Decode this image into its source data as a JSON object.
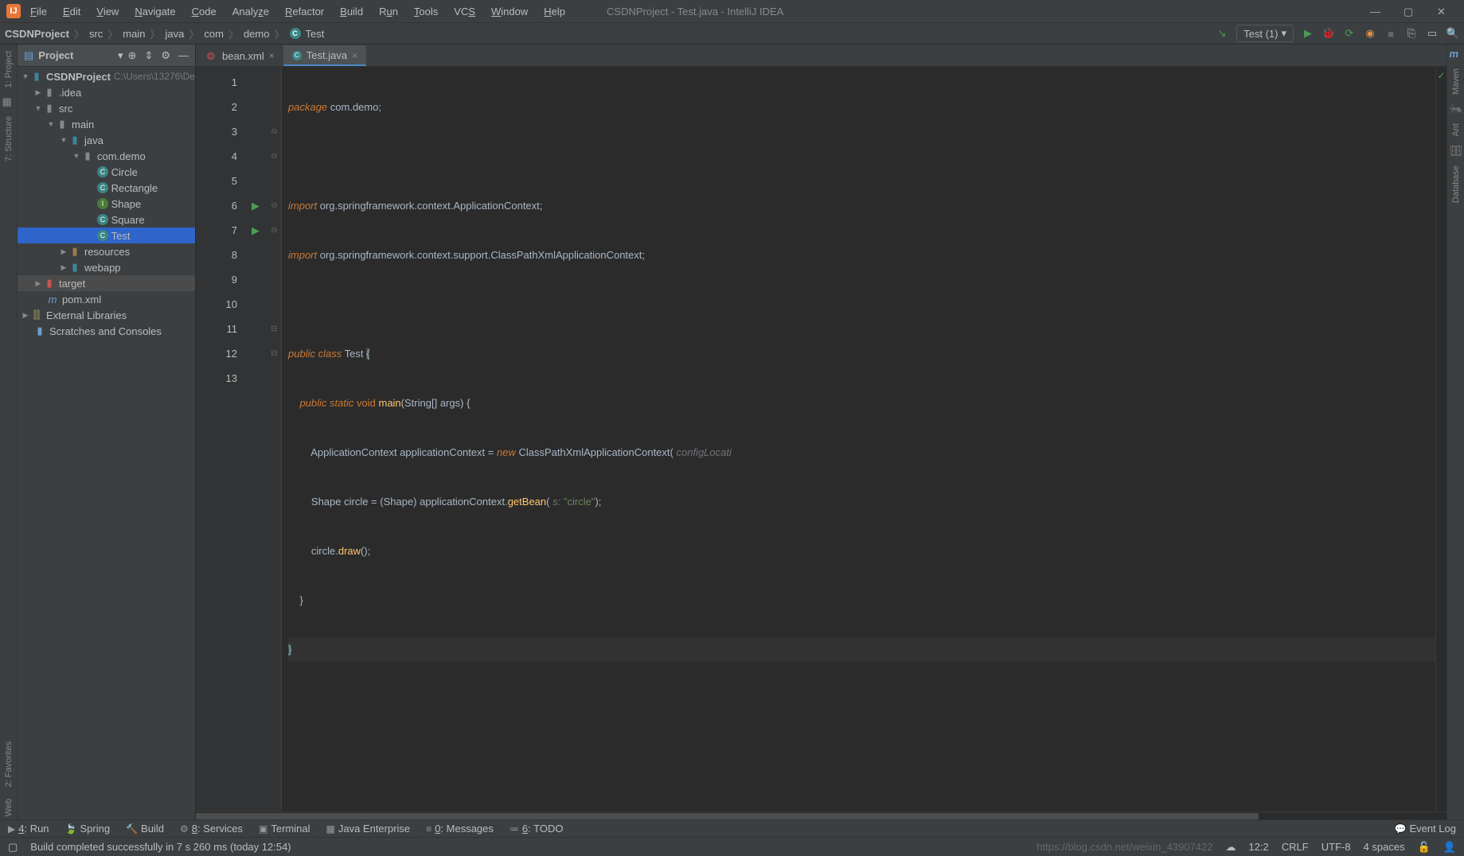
{
  "titlebar": {
    "app_icon": "IJ",
    "title": "CSDNProject - Test.java - IntelliJ IDEA",
    "menu": [
      "File",
      "Edit",
      "View",
      "Navigate",
      "Code",
      "Analyze",
      "Refactor",
      "Build",
      "Run",
      "Tools",
      "VCS",
      "Window",
      "Help"
    ]
  },
  "breadcrumbs": [
    "CSDNProject",
    "src",
    "main",
    "java",
    "com",
    "demo",
    "Test"
  ],
  "toolbar": {
    "run_config": "Test (1)"
  },
  "sidebar": {
    "header": "Project",
    "root": {
      "name": "CSDNProject",
      "path": "C:\\Users\\13276\\De"
    },
    "nodes": {
      "idea": ".idea",
      "src": "src",
      "main": "main",
      "java": "java",
      "pkg": "com.demo",
      "classes": [
        "Circle",
        "Rectangle",
        "Shape",
        "Square",
        "Test"
      ],
      "resources": "resources",
      "webapp": "webapp",
      "target": "target",
      "pom": "pom.xml",
      "extlib": "External Libraries",
      "scratches": "Scratches and Consoles"
    }
  },
  "tabs": [
    {
      "name": "bean.xml",
      "active": false
    },
    {
      "name": "Test.java",
      "active": true
    }
  ],
  "code": {
    "lines": [
      1,
      2,
      3,
      4,
      5,
      6,
      7,
      8,
      9,
      10,
      11,
      12,
      13
    ]
  },
  "bottom": {
    "run": "4: Run",
    "spring": "Spring",
    "build": "Build",
    "services": "8: Services",
    "terminal": "Terminal",
    "javaee": "Java Enterprise",
    "messages": "0: Messages",
    "todo": "6: TODO",
    "eventlog": "Event Log"
  },
  "status": {
    "msg": "Build completed successfully in 7 s 260 ms (today 12:54)",
    "watermark": "https://blog.csdn.net/weixin_43907422",
    "pos": "12:2",
    "crlf": "CRLF",
    "enc": "UTF-8",
    "indent": "4 spaces"
  },
  "right_strip": [
    "Maven",
    "Ant",
    "Database"
  ],
  "left_strip": [
    "1: Project",
    "7: Structure",
    "2: Favorites",
    "Web"
  ]
}
